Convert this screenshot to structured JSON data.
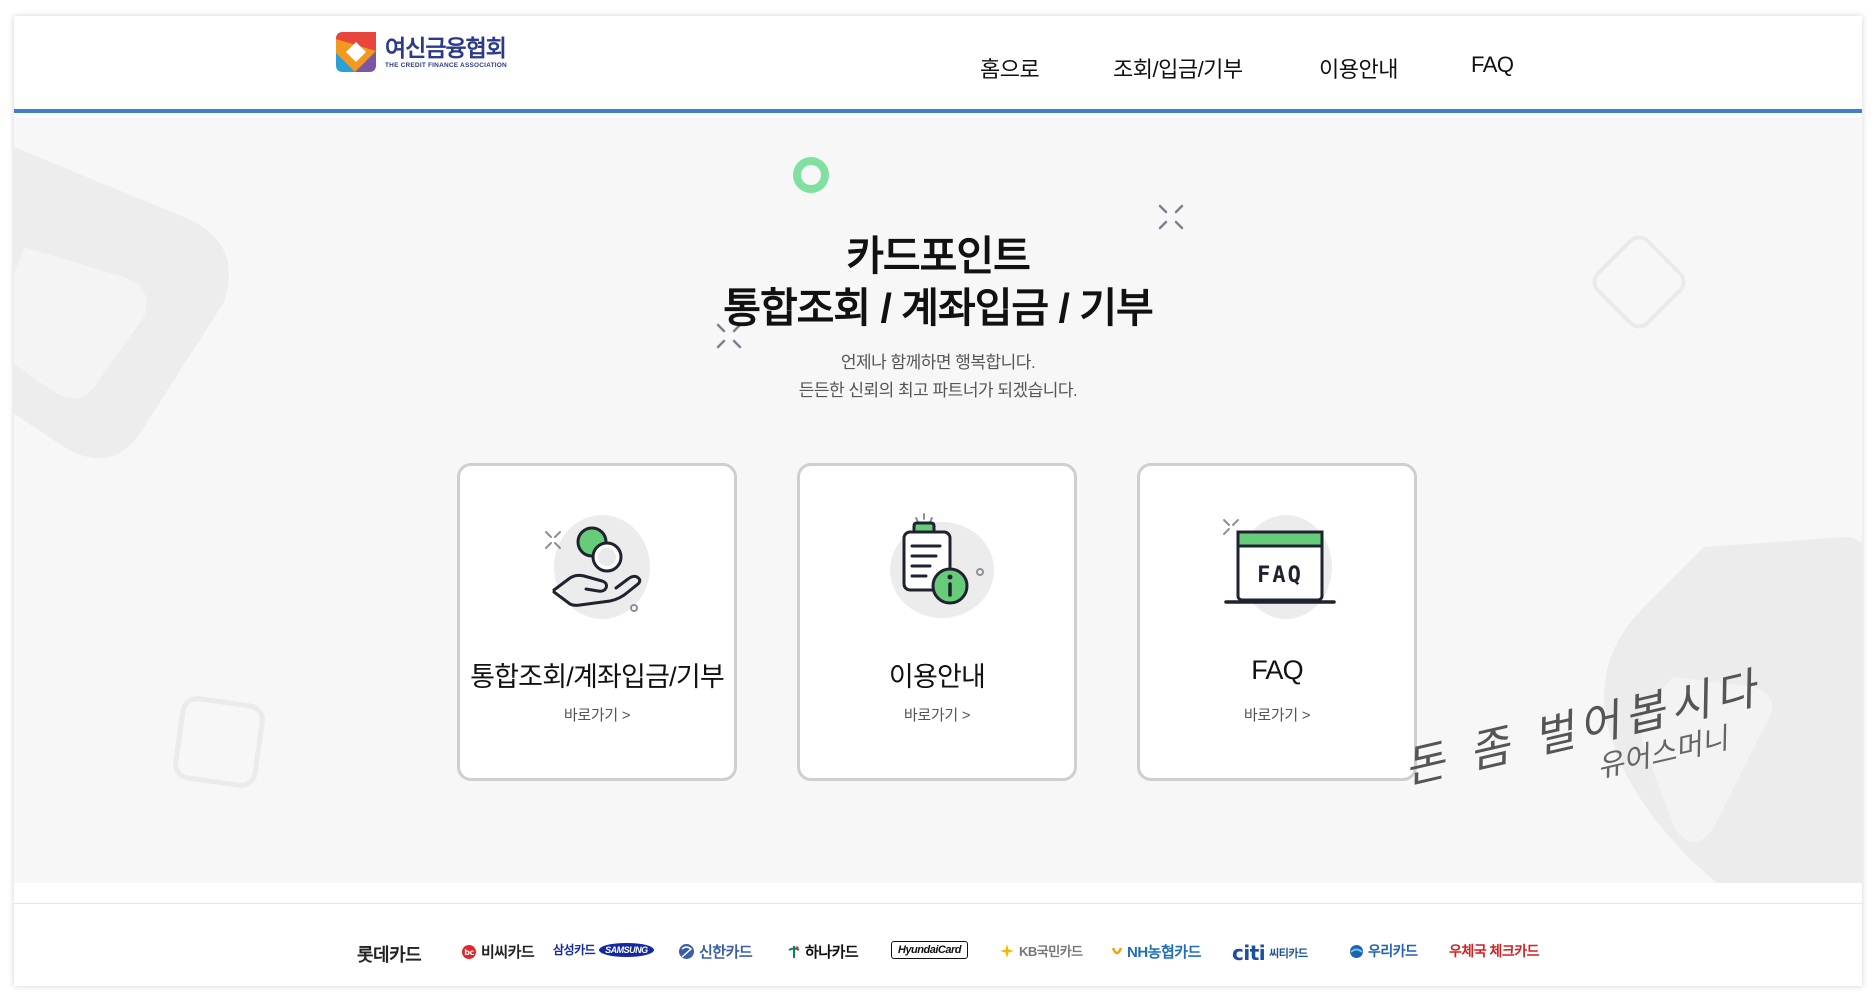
{
  "header": {
    "logo_ko": "여신금융협회",
    "logo_en": "THE CREDIT FINANCE ASSOCIATION",
    "nav": [
      "홈으로",
      "조회/입금/기부",
      "이용안내",
      "FAQ"
    ],
    "accent_color": "#3d7fc8"
  },
  "hero": {
    "title_line1": "카드포인트",
    "title_line2": "통합조회 / 계좌입금 / 기부",
    "subtitle_line1": "언제나 함께하면 행복합니다.",
    "subtitle_line2": "든든한 신뢰의 최고 파트너가 되겠습니다."
  },
  "cards": [
    {
      "title": "통합조회/계좌입금/기부",
      "link": "바로가기 >",
      "icon": "coin-hand-icon"
    },
    {
      "title": "이용안내",
      "link": "바로가기 >",
      "icon": "clipboard-info-icon"
    },
    {
      "title": "FAQ",
      "link": "바로가기 >",
      "icon": "faq-window-icon"
    }
  ],
  "watermark": {
    "line1": "돈 좀 벌어봅시다",
    "line2": "유어스머니"
  },
  "footer": {
    "brands": [
      {
        "label": "롯데카드",
        "color": "#222222"
      },
      {
        "label": "비씨카드",
        "color": "#222222"
      },
      {
        "label": "삼성카드",
        "extra": "SAMSUNG",
        "color": "#1428a0"
      },
      {
        "label": "신한카드",
        "color": "#3a5fa8"
      },
      {
        "label": "하나카드",
        "color": "#111111"
      },
      {
        "label": "HyundaiCard",
        "color": "#111111"
      },
      {
        "label": "KB국민카드",
        "color": "#777777"
      },
      {
        "label": "NH농협카드",
        "color": "#1e6fb8"
      },
      {
        "label": "citi",
        "extra": "씨티카드",
        "color": "#1b4fa0"
      },
      {
        "label": "우리카드",
        "color": "#1f63b0"
      },
      {
        "label": "우체국 체크카드",
        "color": "#d62020"
      }
    ]
  }
}
